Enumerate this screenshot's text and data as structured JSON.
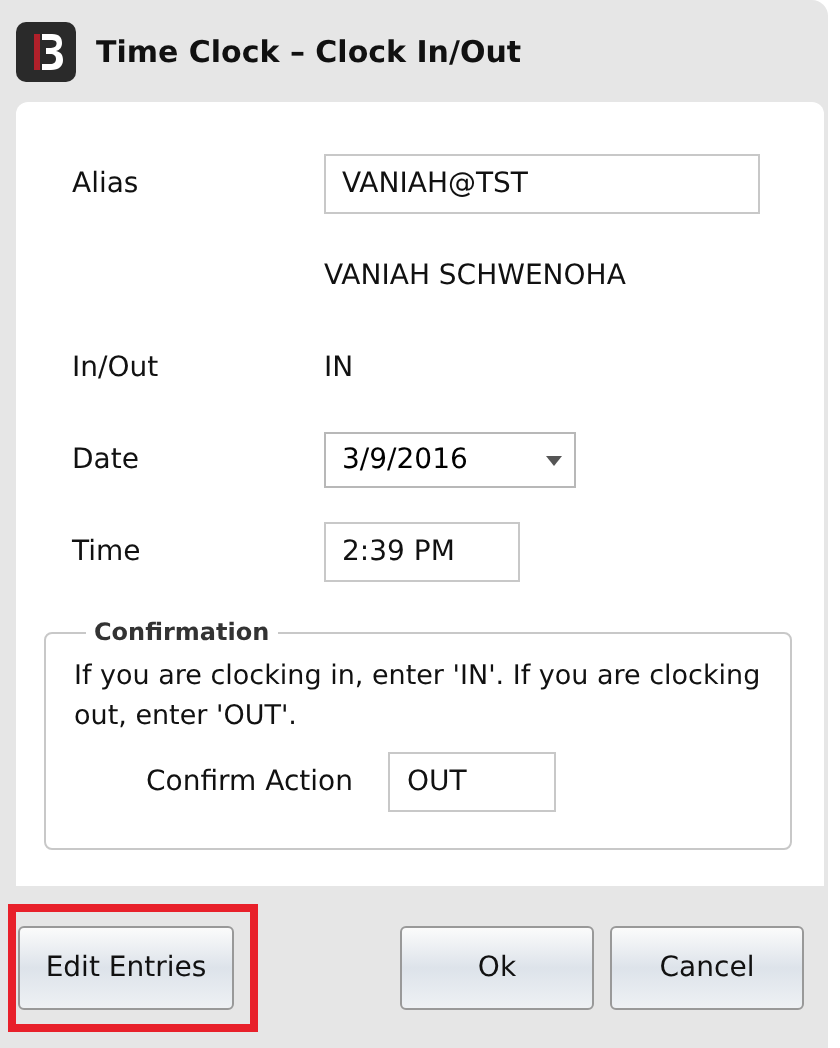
{
  "window": {
    "title": "Time Clock – Clock In/Out"
  },
  "fields": [
    {
      "kind": "input",
      "label": "Alias",
      "value": "VANIAH@TST"
    },
    {
      "kind": "text",
      "value": "VANIAH SCHWENOHA"
    },
    {
      "kind": "text",
      "label": "In/Out",
      "value": "IN"
    },
    {
      "kind": "dropdown",
      "label": "Date",
      "value": "3/9/2016"
    },
    {
      "kind": "narrowinput",
      "label": "Time",
      "value": "2:39 PM"
    }
  ],
  "confirmation": {
    "title": "Confirmation",
    "message": "If you are clocking in, enter 'IN'. If you are clocking out, enter 'OUT'.",
    "label": "Confirm Action",
    "value": "OUT"
  },
  "buttons": [
    {
      "label": "Edit Entries",
      "highlighted": true
    },
    {
      "label": "Ok",
      "highlighted": false
    },
    {
      "label": "Cancel",
      "highlighted": false
    }
  ]
}
